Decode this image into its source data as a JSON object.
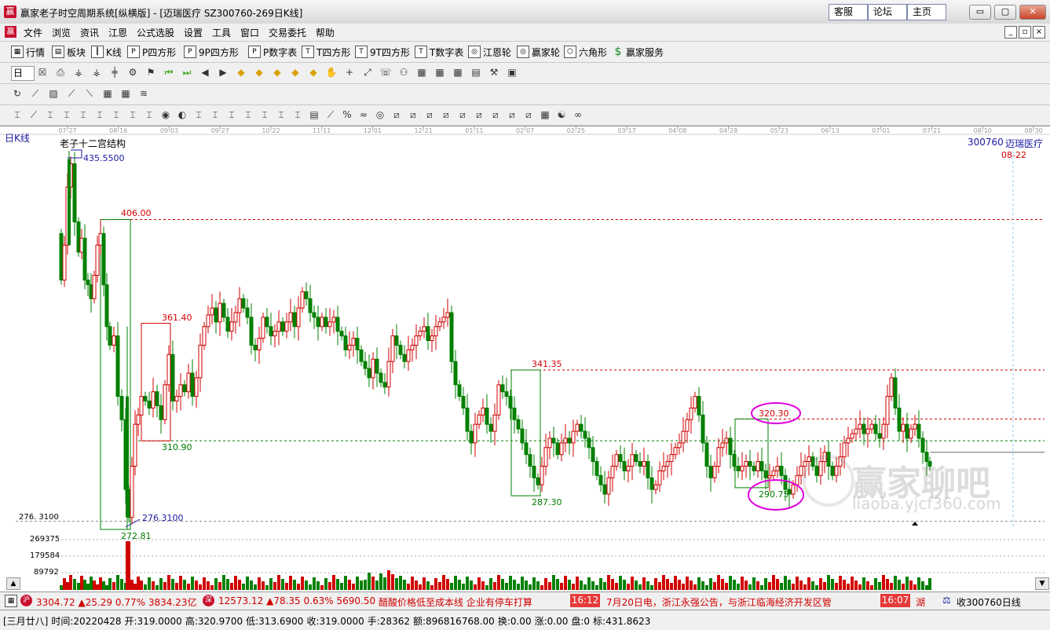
{
  "window": {
    "title": "赢家老子时空周期系统[纵横版] - [迈瑞医疗  SZ300760-269日K线]",
    "logo_text": "赢",
    "links": [
      "客服",
      "论坛",
      "主页"
    ],
    "controls": [
      "▭",
      "▢",
      "✕"
    ]
  },
  "menu": {
    "logo_text": "赢",
    "items": [
      "文件",
      "浏览",
      "资讯",
      "江恩",
      "公式选股",
      "设置",
      "工具",
      "窗口",
      "交易委托",
      "帮助"
    ],
    "mdi_controls": [
      "_",
      "▫",
      "×"
    ]
  },
  "toolbar1": {
    "items": [
      {
        "label": "行情",
        "icon": "table-icon",
        "glyph": "▦"
      },
      {
        "label": "板块",
        "icon": "blocks-icon",
        "glyph": "▤"
      },
      {
        "label": "K线",
        "icon": "candles-icon",
        "glyph": "┃"
      },
      {
        "label": "P四方形",
        "icon": "square-p-icon",
        "glyph": "P"
      },
      {
        "label": "9P四方形",
        "icon": "square-9p-icon",
        "glyph": "P"
      },
      {
        "label": "P数字表",
        "icon": "number-p-icon",
        "glyph": "P"
      },
      {
        "label": "T四方形",
        "icon": "square-t-icon",
        "glyph": "T"
      },
      {
        "label": "9T四方形",
        "icon": "square-9t-icon",
        "glyph": "T"
      },
      {
        "label": "T数字表",
        "icon": "number-t-icon",
        "glyph": "T"
      },
      {
        "label": "江恩轮",
        "icon": "gann-wheel-icon",
        "glyph": "◎"
      },
      {
        "label": "赢家轮",
        "icon": "winner-wheel-icon",
        "glyph": "◎"
      },
      {
        "label": "六角形",
        "icon": "hexagon-icon",
        "glyph": "⬡"
      },
      {
        "label": "赢家服务",
        "icon": "dollar-icon",
        "glyph": "$"
      }
    ]
  },
  "toolbar2": {
    "period_label": "日",
    "glyphs": [
      "☒",
      "⎙",
      "⚶",
      "⚶",
      "╪",
      "⚙",
      "⚑",
      "⏮",
      "⏭",
      "◀",
      "▶",
      "◆",
      "◆",
      "◆",
      "◆",
      "◆",
      "✋",
      "+",
      "⤢",
      "☏",
      "⚇",
      "▦",
      "▦",
      "▦",
      "▤",
      "⚒",
      "▣"
    ]
  },
  "toolbar3": {
    "glyphs": [
      "↻",
      "⟋",
      "▨",
      "⟋",
      "⟍",
      "▦",
      "▦",
      "≋"
    ]
  },
  "toolbar4": {
    "glyphs": [
      "⌶",
      "⟋",
      "⌶",
      "⌶",
      "⌶",
      "⌶",
      "⌶",
      "⌶",
      "⌶",
      "◉",
      "◐",
      "⌶",
      "⌶",
      "⌶",
      "⌶",
      "⌶",
      "⌶",
      "⌶",
      "▤",
      "⟋",
      "%",
      "≈",
      "◎",
      "⧄",
      "⧄",
      "⧄",
      "⧄",
      "⧄",
      "⧄",
      "⧄",
      "⧄",
      "⧄",
      "▦",
      "☯",
      "∞"
    ]
  },
  "chart": {
    "period_label": "日K线",
    "study_title": "老子十二宫结构",
    "stock_code": "300760",
    "stock_name": "迈瑞医疗",
    "cursor_date": "08-22",
    "date_ticks": [
      "07-27",
      "08-16",
      "09-03",
      "09-27",
      "10-22",
      "11-11",
      "12-01",
      "12-21",
      "01-11",
      "02-07",
      "02-25",
      "03-17",
      "04-08",
      "04-28",
      "05-23",
      "06-13",
      "07-01",
      "07-21",
      "08-10",
      "08-30"
    ],
    "price_labels": [
      {
        "text": "435.5500",
        "color": "#1a1aa0"
      },
      {
        "text": "406.00",
        "color": "#d00000"
      },
      {
        "text": "361.40",
        "color": "#d00000"
      },
      {
        "text": "310.90",
        "color": "#007a00"
      },
      {
        "text": "341.35",
        "color": "#d00000"
      },
      {
        "text": "287.30",
        "color": "#007a00"
      },
      {
        "text": "320.30",
        "color": "#d00000"
      },
      {
        "text": "290.75",
        "color": "#007a00"
      },
      {
        "text": "276.3100",
        "color": "#1a1aa0"
      },
      {
        "text": "272.81",
        "color": "#007a00"
      }
    ],
    "axis_price": "276. 3100",
    "vol_labels": [
      "269375",
      "179584",
      "89792"
    ],
    "watermark_big": "赢家聊吧",
    "watermark_small": "liaoba.yjcf360.com",
    "colors": {
      "up": "#d00000",
      "down": "#008000",
      "resistance": "#d00000",
      "support": "#008000",
      "highlight": "#e000e0"
    }
  },
  "statusbar": {
    "sh_index": "3304.72",
    "sh_change": "▲25.29",
    "sh_pct": "0.77%",
    "sh_amount": "3834.23亿",
    "sz_index": "12573.12",
    "sz_change": "▲78.35",
    "sz_pct": "0.63%",
    "sz_amount": "5690.50",
    "news1": "醋酸价格低至成本线 企业有停车打算",
    "news_time1": "16:12",
    "news2": "7月20日电，浙江永强公告，与浙江临海经济开发区管",
    "news_time2": "16:07",
    "news3": "湖",
    "tail": "收300760日线"
  },
  "infobar": {
    "lunar": "[三月廿八]",
    "time": "时间:20220428",
    "open": "开:319.0000",
    "high": "高:320.9700",
    "low": "低:313.6900",
    "close": "收:319.0000",
    "hands": "手:28362",
    "amount": "额:896816768.00",
    "turnover": "换:0.00",
    "change": "涨:0.00",
    "vol": "盘:0",
    "mark": "标:431.8623"
  }
}
